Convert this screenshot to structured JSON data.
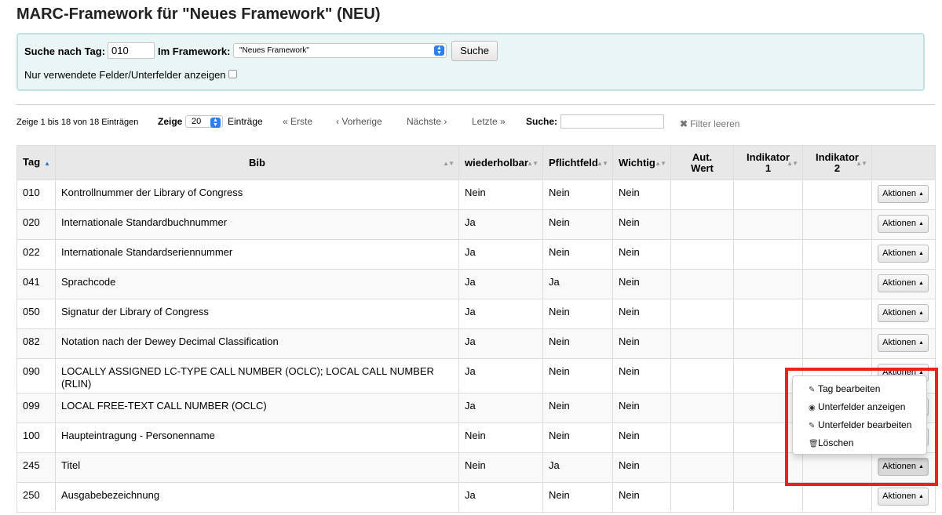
{
  "page": {
    "title": "MARC-Framework für \"Neues Framework\" (NEU)"
  },
  "search": {
    "tag_label": "Suche nach Tag:",
    "tag_value": "010",
    "framework_label": "Im Framework:",
    "framework_value": "\"Neues Framework\"",
    "button_label": "Suche",
    "used_only_label": "Nur verwendete Felder/Unterfelder anzeigen"
  },
  "toolbar": {
    "info": "Zeige 1 bis 18 von 18 Einträgen",
    "show_label": "Zeige",
    "page_length": "20",
    "entries_label": "Einträge",
    "first": "« Erste",
    "prev": "‹ Vorherige",
    "next": "Nächste ›",
    "last": "Letzte »",
    "search_label": "Suche:",
    "clear_filter": "Filter leeren"
  },
  "table": {
    "headers": {
      "tag": "Tag",
      "bib": "Bib",
      "repeatable": "wiederholbar",
      "mandatory": "Pflichtfeld",
      "important": "Wichtig",
      "aut_value": "Aut. Wert",
      "ind1": "Indikator 1",
      "ind2": "Indikator 2"
    },
    "action_label": "Aktionen",
    "rows": [
      {
        "tag": "010",
        "bib": "Kontrollnummer der Library of Congress",
        "rep": "Nein",
        "mand": "Nein",
        "imp": "Nein"
      },
      {
        "tag": "020",
        "bib": "Internationale Standardbuchnummer",
        "rep": "Ja",
        "mand": "Nein",
        "imp": "Nein"
      },
      {
        "tag": "022",
        "bib": "Internationale Standardseriennummer",
        "rep": "Ja",
        "mand": "Nein",
        "imp": "Nein"
      },
      {
        "tag": "041",
        "bib": "Sprachcode",
        "rep": "Ja",
        "mand": "Ja",
        "imp": "Nein"
      },
      {
        "tag": "050",
        "bib": "Signatur der Library of Congress",
        "rep": "Ja",
        "mand": "Nein",
        "imp": "Nein"
      },
      {
        "tag": "082",
        "bib": "Notation nach der Dewey Decimal Classification",
        "rep": "Ja",
        "mand": "Nein",
        "imp": "Nein"
      },
      {
        "tag": "090",
        "bib": "LOCALLY ASSIGNED LC-TYPE CALL NUMBER (OCLC); LOCAL CALL NUMBER (RLIN)",
        "rep": "Ja",
        "mand": "Nein",
        "imp": "Nein"
      },
      {
        "tag": "099",
        "bib": "LOCAL FREE-TEXT CALL NUMBER (OCLC)",
        "rep": "Ja",
        "mand": "Nein",
        "imp": "Nein"
      },
      {
        "tag": "100",
        "bib": "Haupteintragung - Personenname",
        "rep": "Nein",
        "mand": "Nein",
        "imp": "Nein"
      },
      {
        "tag": "245",
        "bib": "Titel",
        "rep": "Nein",
        "mand": "Ja",
        "imp": "Nein"
      },
      {
        "tag": "250",
        "bib": "Ausgabebezeichnung",
        "rep": "Ja",
        "mand": "Nein",
        "imp": "Nein"
      }
    ]
  },
  "dropdown": {
    "items": [
      {
        "label": "Tag bearbeiten",
        "icon": "pencil-icon"
      },
      {
        "label": "Unterfelder anzeigen",
        "icon": "eye-icon"
      },
      {
        "label": "Unterfelder bearbeiten",
        "icon": "pencil-icon"
      },
      {
        "label": "Löschen",
        "icon": "trash-icon"
      }
    ]
  },
  "colors": {
    "search_box_bg": "#eaf6f5",
    "search_box_border": "#bfe4e0",
    "header_bg": "#e8e8e8",
    "highlight_border": "#e8231f",
    "sort_active": "#2a6fd6"
  }
}
